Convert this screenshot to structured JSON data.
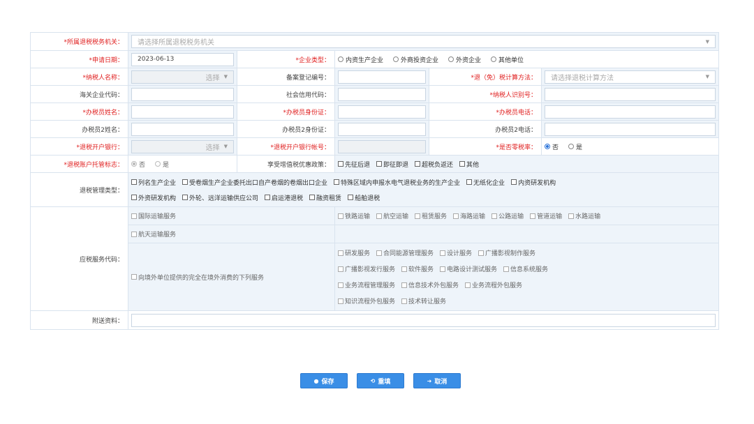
{
  "labels": {
    "tax_authority": "*所属退税税务机关：",
    "apply_date": "*申请日期：",
    "enterprise_type": "*企业类型：",
    "taxpayer_name": "*纳税人名称：",
    "record_no": "备案登记编号：",
    "calc_method": "*退（免）税计算方法：",
    "customs_code": "海关企业代码：",
    "social_credit": "社会信用代码：",
    "taxpayer_id": "*纳税人识别号：",
    "agent_name": "*办税员姓名：",
    "agent_id": "*办税员身份证：",
    "agent_phone": "*办税员电话：",
    "agent2_name": "办税员2姓名：",
    "agent2_id": "办税员2身份证：",
    "agent2_phone": "办税员2电话：",
    "refund_bank": "*退税开户银行：",
    "refund_account": "*退税开户银行帐号：",
    "zero_rate": "*是否零税率：",
    "escrow_flag": "*退税账户托管标志：",
    "vat_policy": "享受增值税优惠政策：",
    "mgmt_type": "退税管理类型：",
    "service_code": "应税服务代码：",
    "attachment": "附送资料："
  },
  "values": {
    "tax_authority_placeholder": "请选择所属退税税务机关",
    "apply_date": "2023-06-13",
    "select_label": "选择",
    "calc_method_placeholder": "请选择退税计算方法"
  },
  "enterprise_types": [
    "内资生产企业",
    "外商投资企业",
    "外资企业",
    "其他单位"
  ],
  "zero_rate_options": [
    "否",
    "是"
  ],
  "escrow_options": [
    "否",
    "是"
  ],
  "vat_policies": [
    "先征后退",
    "即征即退",
    "超税负返还",
    "其他"
  ],
  "mgmt_types_row1": [
    "列名生产企业",
    "受卷烟生产企业委托出口自产卷烟的卷烟出口企业",
    "特殊区域内申报水电气退税业务的生产企业",
    "无纸化企业",
    "内资研发机构"
  ],
  "mgmt_types_row2": [
    "外资研发机构",
    "外轮、远洋运输供应公司",
    "启运港退税",
    "融资租赁",
    "船舶退税"
  ],
  "services": {
    "intl_transport": "国际运输服务",
    "transport_items": [
      "铁路运输",
      "航空运输",
      "租赁服务",
      "海路运输",
      "公路运输",
      "管道运输",
      "水路运输"
    ],
    "space_transport": "航天运输服务",
    "overseas_service": "向境外单位提供的完全在境外消费的下列服务",
    "overseas_items": [
      [
        "研发服务",
        "合同能源管理服务",
        "设计服务",
        "广播影视制作服务"
      ],
      [
        "广播影视发行服务",
        "软件服务",
        "电路设计测试服务",
        "信息系统服务"
      ],
      [
        "业务流程管理服务",
        "信息技术外包服务",
        "业务流程外包服务"
      ],
      [
        "知识流程外包服务",
        "技术转让服务"
      ]
    ]
  },
  "buttons": {
    "save": "保存",
    "reset": "重填",
    "cancel": "取消"
  },
  "colors": {
    "primary": "#3a8ee6",
    "required": "#e02020",
    "cell_bg": "#eef4fa",
    "border": "#d9e3ee"
  }
}
